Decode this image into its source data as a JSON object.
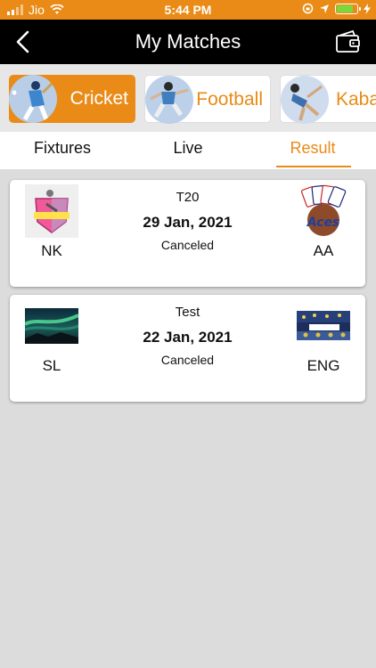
{
  "status_bar": {
    "carrier": "Jio",
    "time": "5:44 PM"
  },
  "header": {
    "title": "My Matches"
  },
  "sports": [
    {
      "label": "Cricket",
      "active": true
    },
    {
      "label": "Football",
      "active": false
    },
    {
      "label": "Kaba",
      "active": false
    }
  ],
  "tabs": [
    {
      "label": "Fixtures"
    },
    {
      "label": "Live"
    },
    {
      "label": "Result"
    }
  ],
  "active_tab": "Result",
  "matches": [
    {
      "format": "T20",
      "date": "29 Jan, 2021",
      "status": "Canceled",
      "team1": {
        "abbr": "NK"
      },
      "team2": {
        "abbr": "AA"
      }
    },
    {
      "format": "Test",
      "date": "22 Jan, 2021",
      "status": "Canceled",
      "team1": {
        "abbr": "SL"
      },
      "team2": {
        "abbr": "ENG"
      }
    }
  ],
  "colors": {
    "accent": "#e98b16",
    "navbar": "#000000",
    "background": "#dcdcdc"
  }
}
